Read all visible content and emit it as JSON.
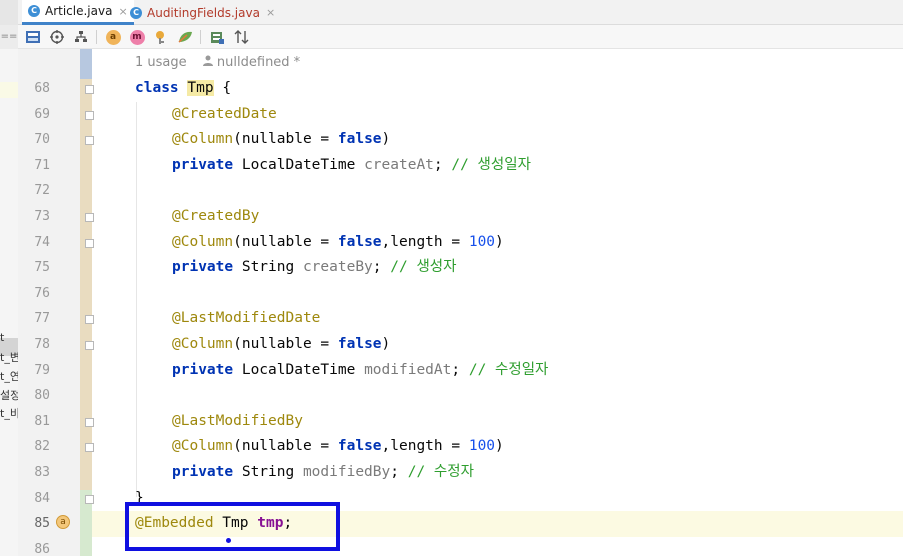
{
  "tabs": [
    {
      "label": "Article.java",
      "icon": "java-class-icon",
      "active": true
    },
    {
      "label": "AuditingFields.java",
      "icon": "java-class-icon",
      "active": false
    }
  ],
  "tab_close_glyph": "×",
  "toolbar": {
    "left_marker": "==",
    "icons": [
      "dou-icon",
      "crosshair-icon",
      "hierarchy-icon",
      "annotation-badge-icon",
      "method-badge-icon",
      "property-icon",
      "leaf-icon",
      "database-icon",
      "sort-icon"
    ],
    "badge_a": "a",
    "badge_m": "m"
  },
  "project_fragments": [
    "t",
    "t_변",
    "t_연",
    "설정",
    "t_비"
  ],
  "inlay": {
    "usage": "1 usage",
    "author": "nulldefined *"
  },
  "lines": [
    {
      "n": "68"
    },
    {
      "n": "69"
    },
    {
      "n": "70"
    },
    {
      "n": "71"
    },
    {
      "n": "72"
    },
    {
      "n": "73"
    },
    {
      "n": "74"
    },
    {
      "n": "75"
    },
    {
      "n": "76"
    },
    {
      "n": "77"
    },
    {
      "n": "78"
    },
    {
      "n": "79"
    },
    {
      "n": "80"
    },
    {
      "n": "81"
    },
    {
      "n": "82"
    },
    {
      "n": "83"
    },
    {
      "n": "84"
    },
    {
      "n": "85"
    },
    {
      "n": "86"
    }
  ],
  "code": {
    "class_kw": "class",
    "class_name": "Tmp",
    "open_brace": " {",
    "close_brace": "}",
    "created_date": "@CreatedDate",
    "created_by": "@CreatedBy",
    "last_modified_date": "@LastModifiedDate",
    "last_modified_by": "@LastModifiedBy",
    "column": "@Column",
    "nullable_open": "(nullable = ",
    "false_kw": "false",
    "close_paren": ")",
    "length_part": ",length = ",
    "length_val": "100",
    "private_kw": "private",
    "localdatetime": " LocalDateTime ",
    "string_type": " String ",
    "created_at": "createAt",
    "create_by": "createBy",
    "modified_at": "modifiedAt",
    "modified_by": "modifiedBy",
    "semicolon": ";",
    "comment_created_at": " // 생성일자",
    "comment_create_by": " // 생성자",
    "comment_modified_at": " // 수정일자",
    "comment_modified_by": " // 수정자",
    "embedded": "@Embedded",
    "embedded_type": " Tmp ",
    "embedded_field": "tmp",
    "embedded_semicolon": ";"
  },
  "gutter_badge": "a",
  "colors": {
    "keyword": "#0033b3",
    "annotation": "#9e880d",
    "comment": "#2f9e2f",
    "number": "#1750eb",
    "highlight_box": "#1010e0"
  }
}
